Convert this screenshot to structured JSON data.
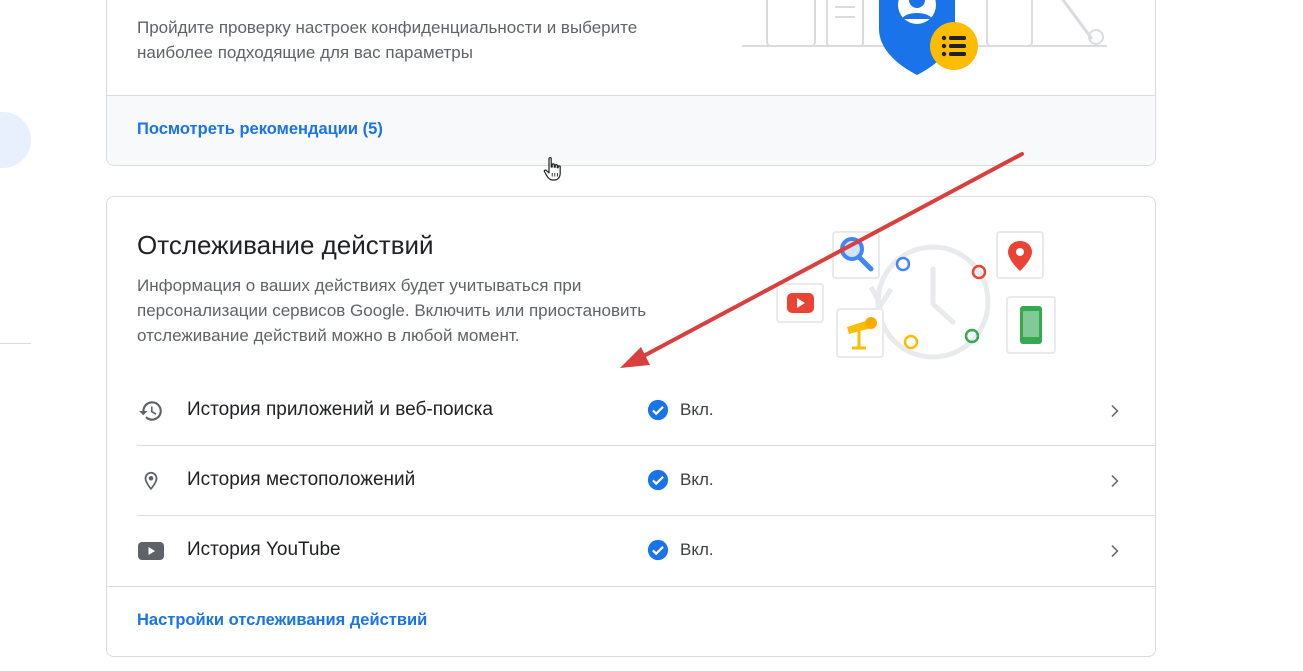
{
  "privacy_card": {
    "description": "Пройдите проверку настроек конфиденциальности и выберите наиболее подходящие для вас параметры",
    "link_label": "Посмотреть рекомендации (5)"
  },
  "activity_card": {
    "title": "Отслеживание действий",
    "description": "Информация о ваших действиях будет учитываться при персонализации сервисов Google. Включить или приостановить отслеживание действий можно в любой момент.",
    "items": [
      {
        "label": "История приложений и веб-поиска",
        "status": "Вкл.",
        "icon": "history-icon"
      },
      {
        "label": "История местоположений",
        "status": "Вкл.",
        "icon": "location-pin-icon"
      },
      {
        "label": "История YouTube",
        "status": "Вкл.",
        "icon": "youtube-icon"
      }
    ],
    "footer_link_label": "Настройки отслеживания действий"
  },
  "colors": {
    "link": "#1a73e8",
    "check": "#1a73e8",
    "arrow": "#d93f3c",
    "border": "#dadce0"
  }
}
